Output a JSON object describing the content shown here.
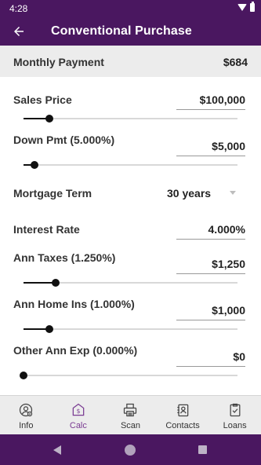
{
  "status": {
    "time": "4:28"
  },
  "header": {
    "title": "Conventional Purchase"
  },
  "summary": {
    "label": "Monthly Payment",
    "value": "$684"
  },
  "fields": {
    "sales_price": {
      "label": "Sales Price",
      "value": "$100,000",
      "slider_fraction": 0.12
    },
    "down_pmt": {
      "label": "Down Pmt (5.000%)",
      "value": "$5,000",
      "slider_fraction": 0.05
    },
    "term": {
      "label": "Mortgage Term",
      "value": "30 years"
    },
    "interest": {
      "label": "Interest Rate",
      "value": "4.000%"
    },
    "ann_taxes": {
      "label": "Ann Taxes (1.250%)",
      "value": "$1,250",
      "slider_fraction": 0.15
    },
    "home_ins": {
      "label": "Ann Home Ins (1.000%)",
      "value": "$1,000",
      "slider_fraction": 0.12
    },
    "other_exp": {
      "label": "Other Ann Exp (0.000%)",
      "value": "$0",
      "slider_fraction": 0.0
    }
  },
  "tabs": [
    {
      "label": "Info",
      "icon": "info-person-icon"
    },
    {
      "label": "Calc",
      "icon": "calculator-icon",
      "active": true
    },
    {
      "label": "Scan",
      "icon": "printer-icon"
    },
    {
      "label": "Contacts",
      "icon": "contacts-icon"
    },
    {
      "label": "Loans",
      "icon": "clipboard-check-icon"
    }
  ],
  "colors": {
    "primary": "#4a1760",
    "active_tab": "#7a3b92",
    "summary_bg": "#ececec"
  }
}
